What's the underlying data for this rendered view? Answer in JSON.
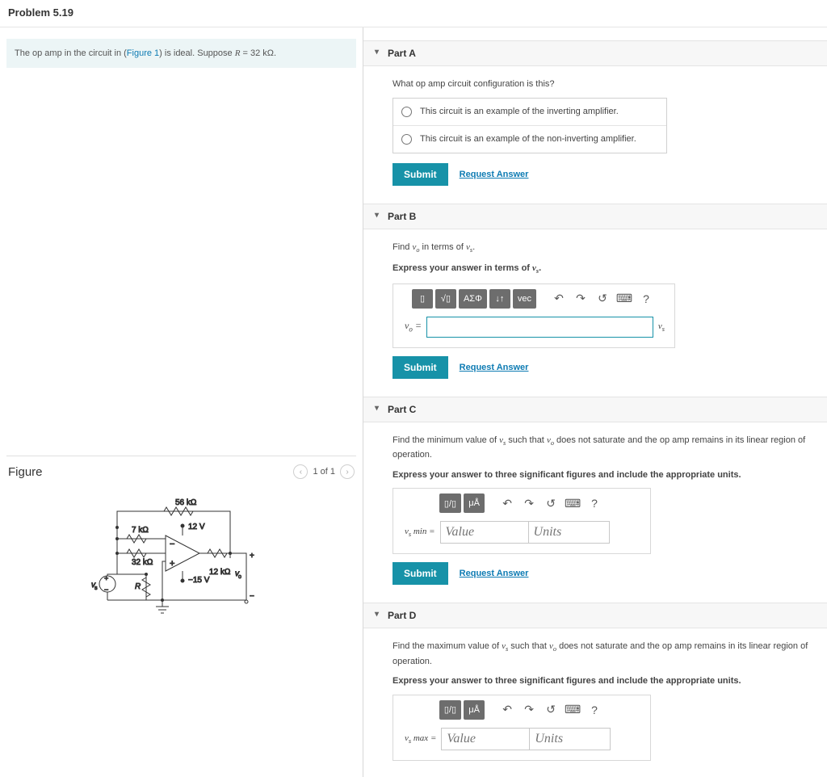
{
  "title": "Problem 5.19",
  "prompt": {
    "pre": "The op amp in the circuit in (",
    "fig_link": "Figure 1",
    "post": ") is ideal. Suppose ",
    "var": "R",
    "eq": " = 32  kΩ."
  },
  "figure": {
    "title": "Figure",
    "nav": "1 of 1",
    "labels": {
      "r56": "56 kΩ",
      "r7": "7 kΩ",
      "r32": "32 kΩ",
      "vp": "12 V",
      "vn": "−15 V",
      "r12": "12 kΩ",
      "R": "R",
      "vs": "v",
      "vo": "v"
    }
  },
  "submit": "Submit",
  "request": "Request Answer",
  "partA": {
    "title": "Part A",
    "q": "What op amp circuit configuration is this?",
    "opt1": "This circuit is an example of the inverting amplifier.",
    "opt2": "This circuit is an example of the non-inverting amplifier."
  },
  "partB": {
    "title": "Part B",
    "q_pre": "Find ",
    "q_mid": " in terms of ",
    "q_post": ".",
    "instr_pre": "Express your answer in terms of ",
    "instr_post": ".",
    "lhs_v": "v",
    "lhs_sub": "o",
    "rhs_v": "v",
    "rhs_sub": "s",
    "tools": {
      "tmpl": "▯",
      "sqrt": "√▯",
      "asig": "ΑΣΦ",
      "updown": "↓↑",
      "vec": "vec",
      "help": "?"
    }
  },
  "partC": {
    "title": "Part C",
    "q_pre": "Find the minimum value of ",
    "q_mid": " such that ",
    "q_post": " does not saturate and the op amp remains in its linear region of operation.",
    "instr": "Express your answer to three significant figures and include the appropriate units.",
    "lhs_v": "v",
    "lhs_sub": "s",
    "lhs_suffix": " min",
    "value_ph": "Value",
    "units_ph": "Units",
    "tools": {
      "frac": "▯/▯",
      "ua": "μÅ",
      "help": "?"
    },
    "vo_v": "v",
    "vo_sub": "o",
    "vs_v": "v",
    "vs_sub": "s"
  },
  "partD": {
    "title": "Part D",
    "q_pre": "Find the maximum value of ",
    "q_mid": " such that ",
    "q_post": " does not saturate and the op amp remains in its linear region of operation.",
    "instr": "Express your answer to three significant figures and include the appropriate units.",
    "lhs_v": "v",
    "lhs_sub": "s",
    "lhs_suffix": " max",
    "value_ph": "Value",
    "units_ph": "Units"
  }
}
